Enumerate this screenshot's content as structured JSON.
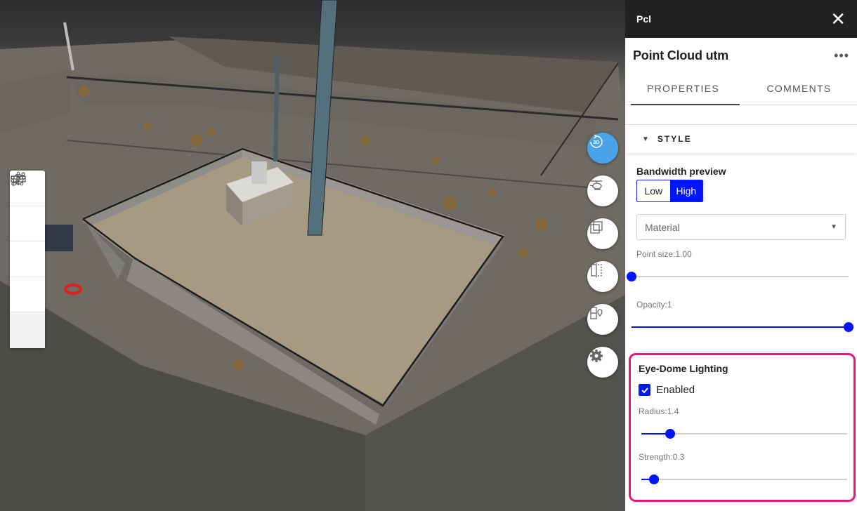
{
  "panel": {
    "header_title": "Pcl",
    "close_glyph": "✕",
    "layer_title": "Point Cloud utm",
    "more_glyph": "•••",
    "tabs": [
      {
        "label": "PROPERTIES",
        "active": true
      },
      {
        "label": "COMMENTS",
        "active": false
      }
    ],
    "style_section": {
      "label": "STYLE",
      "bandwidth": {
        "label": "Bandwidth preview",
        "options": [
          "Low",
          "High"
        ],
        "selected": "High"
      },
      "material": {
        "placeholder": "Material"
      },
      "point_size": {
        "label": "Point size:1.00",
        "fraction": 0.0
      },
      "opacity": {
        "label": "Opacity:1",
        "fraction": 1.0
      },
      "eye_dome": {
        "label": "Eye-Dome Lighting",
        "enabled_label": "Enabled",
        "enabled": true,
        "radius": {
          "label": "Radius:1.4",
          "fraction": 0.14
        },
        "strength": {
          "label": "Strength:0.3",
          "fraction": 0.06
        }
      }
    }
  },
  "left_tools": [
    "crosshair-icon",
    "line-measure-icon",
    "polygon-icon",
    "ruler-icon",
    "chevron-right-icon"
  ],
  "right_tools": [
    "3d-rotate-icon",
    "helicopter-icon",
    "layers-icon",
    "split-view-icon",
    "map-pin-icon",
    "gear-icon"
  ],
  "colors": {
    "accent": "#0014ff",
    "active_fab": "#4aa3e8",
    "highlight": "#e8167a",
    "header_bg": "#212121"
  }
}
